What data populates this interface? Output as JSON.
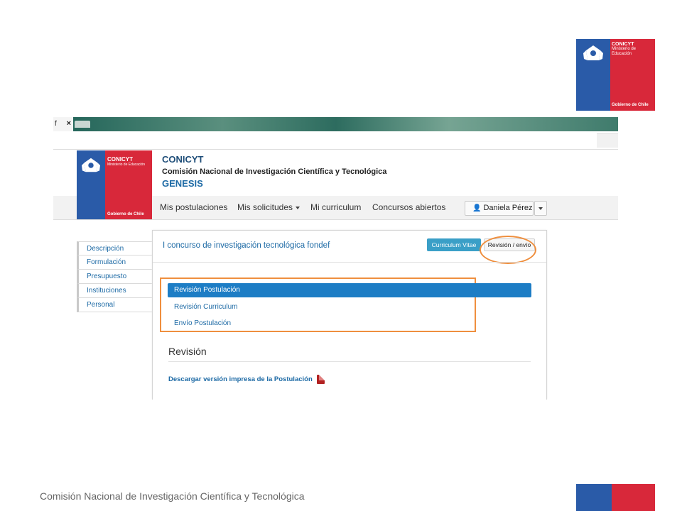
{
  "slide": {
    "footer_text": "Comisión Nacional de Investigación Científica y Tecnológica",
    "logo": {
      "brand": "CONICYT",
      "ministry": "Ministerio de Educación",
      "government": "Gobierno de Chile"
    }
  },
  "browser": {
    "tab_label": "f",
    "tab_close": "×"
  },
  "site": {
    "logo": {
      "brand": "CONICYT",
      "ministry": "Ministerio de Educación",
      "government": "Gobierno de Chile"
    },
    "title": "CONICYT",
    "subtitle": "Comisión Nacional de Investigación Científica y Tecnológica",
    "app_name": "GENESIS"
  },
  "nav": {
    "items": [
      "Mis postulaciones",
      "Mis solicitudes",
      "Mi curriculum",
      "Concursos abiertos"
    ],
    "user": "Daniela Pérez"
  },
  "sidebar": {
    "items": [
      "Descripción",
      "Formulación",
      "Presupuesto",
      "Instituciones",
      "Personal"
    ]
  },
  "panel": {
    "title": "I concurso de investigación tecnológica fondef",
    "cv_button": "Curriculum Vitae",
    "review_button": "Revisión / envío",
    "steps": [
      "Revisión Postulación",
      "Revisión Curriculum",
      "Envío Postulación"
    ],
    "active_step": 0,
    "section_heading": "Revisión",
    "download_link": "Descargar versión impresa de la Postulación"
  },
  "colors": {
    "brand_blue": "#2a5ba8",
    "brand_red": "#d8283a",
    "link_blue": "#1d6aa5",
    "highlight_orange": "#ef8f3e"
  }
}
